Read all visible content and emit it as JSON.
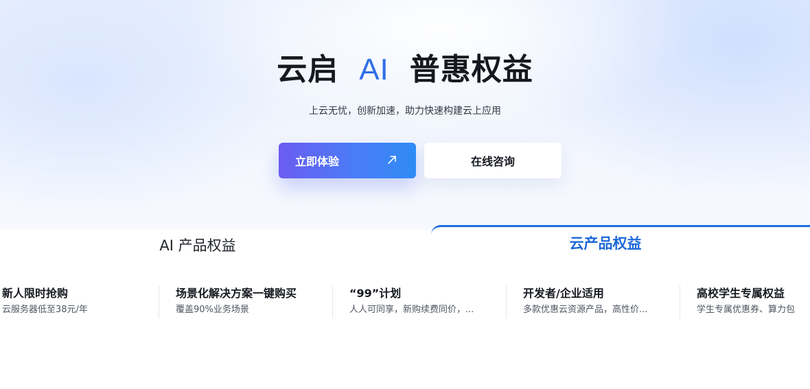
{
  "hero": {
    "title_part1": "云启",
    "title_ai": "AI",
    "title_part2": "普惠权益",
    "subtitle": "上云无忧，创新加速，助力快速构建云上应用",
    "primary_button": "立即体验",
    "secondary_button": "在线咨询"
  },
  "colors": {
    "accent": "#2f6fe6",
    "active_tab": "#1b67d9"
  },
  "tabs": [
    {
      "label": "AI 产品权益",
      "active": false
    },
    {
      "label": "云产品权益",
      "active": true
    }
  ],
  "benefits": [
    {
      "title": "新人限时抢购",
      "desc": "云服务器低至38元/年"
    },
    {
      "title": "场景化解决方案一键购买",
      "desc": "覆盖90%业务场景"
    },
    {
      "title": "“99”计划",
      "desc": "人人可同享，新购续费同价，..."
    },
    {
      "title": "开发者/企业适用",
      "desc": "多款优惠云资源产品，高性价..."
    },
    {
      "title": "高校学生专属权益",
      "desc": "学生专属优惠券、算力包"
    }
  ]
}
